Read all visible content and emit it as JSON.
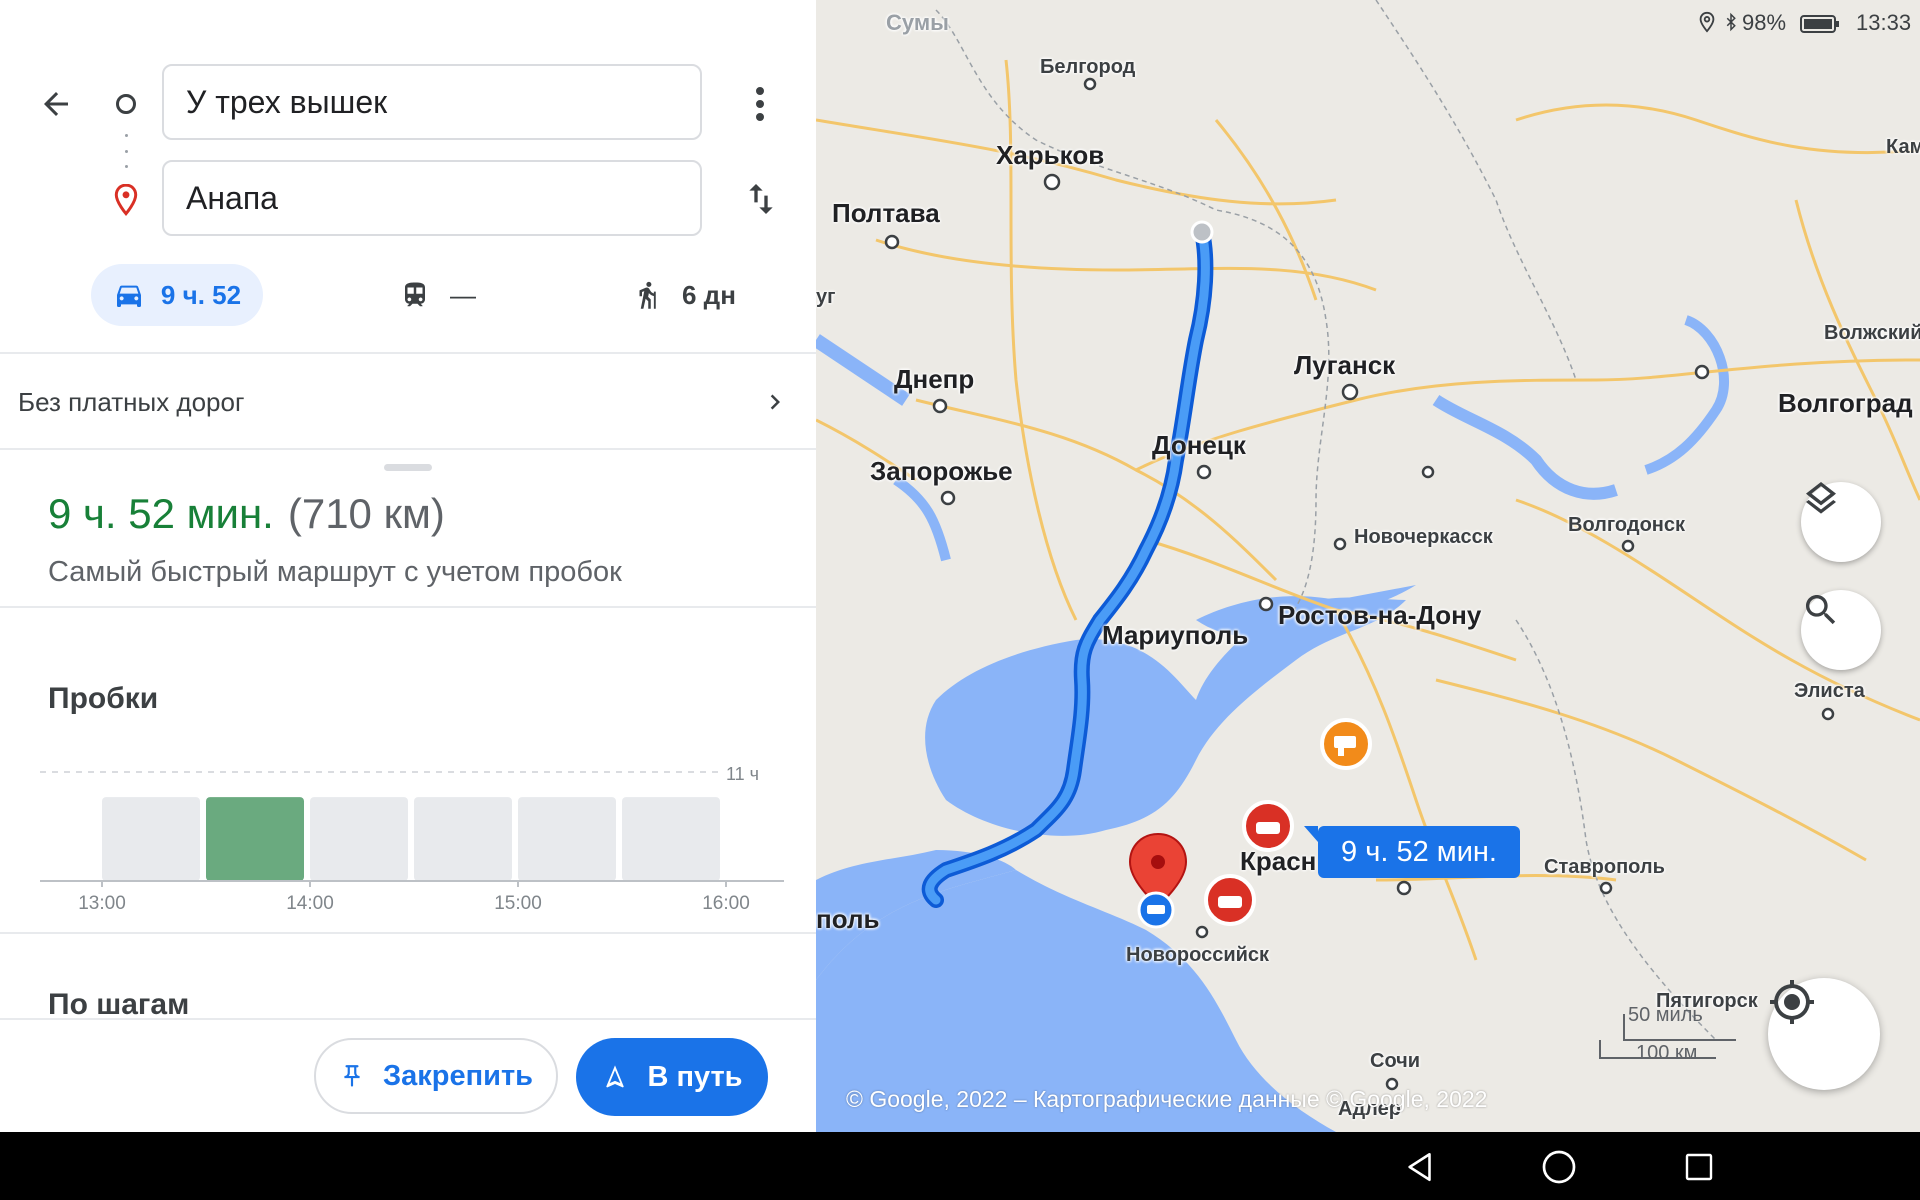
{
  "search": {
    "origin": "У трех вышек",
    "destination": "Анапа"
  },
  "modes": {
    "car": "9 ч. 52",
    "transit": "—",
    "walk": "6 дн"
  },
  "route_options": {
    "tolls_label": "Без платных дорог"
  },
  "summary": {
    "time": "9 ч. 52 мин.",
    "distance": "(710 км)",
    "description": "Самый быстрый маршрут с учетом пробок"
  },
  "traffic": {
    "title": "Пробки",
    "max_label": "11 ч",
    "time_labels": [
      "13:00",
      "14:00",
      "15:00",
      "16:00"
    ],
    "bars": [
      0.77,
      0.77,
      0.77,
      0.77,
      0.77,
      0.77
    ],
    "highlighted_bar": 1,
    "bar_color": "#e8eaed",
    "highlight_color": "#6aaa7f"
  },
  "steps": {
    "title": "По шагам"
  },
  "actions": {
    "pin": "Закрепить",
    "go": "В путь"
  },
  "status_bar": {
    "battery": "98%",
    "time": "13:33"
  },
  "map": {
    "route_time": "9 ч. 52 мин.",
    "copyright": "© Google, 2022 – Картографические данные © Google, 2022",
    "scale_mi": "50 миль",
    "scale_km": "100 км",
    "route_color": "#1a73e8",
    "water_color": "#8ab4f8",
    "cities": {
      "sumy": "Сумы",
      "belgorod": "Белгород",
      "kharkov": "Харьков",
      "poltava": "Полтава",
      "kam": "Кам",
      "volzhsky": "Волжский",
      "volgograd": "Волгоград",
      "yug": "уг",
      "dnepr": "Днепр",
      "lugansk": "Луганск",
      "donetsk": "Донецк",
      "zaporozhye": "Запорожье",
      "novocherkassk": "Новочеркасск",
      "volgodonsk": "Волгодонск",
      "rostov": "Ростов-на-Дону",
      "mariupol": "Мариуполь",
      "elista": "Элиста",
      "krasnodar": "Красн",
      "stavropol": "Ставрополь",
      "pol": "поль",
      "novorossiysk": "Новороссийск",
      "pyatigorsk": "Пятигорск",
      "sochi": "Сочи",
      "adler": "Адлер"
    }
  }
}
